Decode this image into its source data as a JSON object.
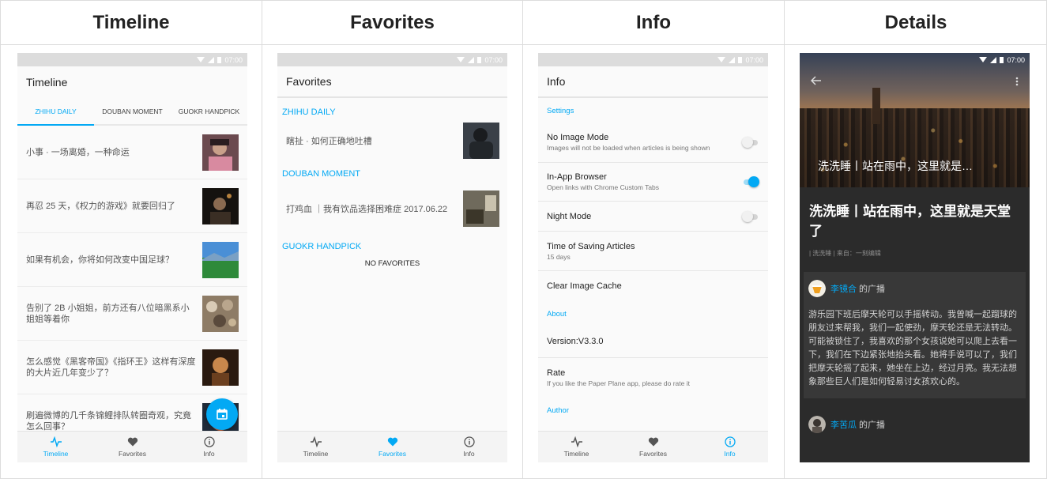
{
  "columns": {
    "timeline": "Timeline",
    "favorites": "Favorites",
    "info": "Info",
    "details": "Details"
  },
  "status": {
    "time": "07:00"
  },
  "nav": {
    "timeline": "Timeline",
    "favorites": "Favorites",
    "info": "Info"
  },
  "colors": {
    "accent": "#03a9f4"
  },
  "timeline": {
    "title": "Timeline",
    "tabs": [
      "ZHIHU DAILY",
      "DOUBAN MOMENT",
      "GUOKR HANDPICK"
    ],
    "items": [
      "小事 · 一场离婚，一种命运",
      "再忍 25 天，《权力的游戏》就要回归了",
      "如果有机会，你将如何改变中国足球？",
      "告别了 2B 小姐姐，前方还有八位暗黑系小姐姐等着你",
      "怎么感觉《黑客帝国》《指环王》这样有深度的大片近几年变少了？",
      "刷遍微博的几千条锦鲤排队转圈奇观，究竟怎么回事？"
    ]
  },
  "favorites": {
    "title": "Favorites",
    "sections": {
      "zhihu": "ZHIHU DAILY",
      "douban": "DOUBAN MOMENT",
      "guokr": "GUOKR HANDPICK"
    },
    "zhihu_item": "瞎扯 · 如何正确地吐槽",
    "douban_item": "打鸡血 ｜我有饮品选择困难症 2017.06.22",
    "empty": "NO FAVORITES"
  },
  "info": {
    "title": "Info",
    "settings_header": "Settings",
    "no_image_title": "No Image Mode",
    "no_image_sub": "Images will not be loaded when articles is being shown",
    "browser_title": "In-App Browser",
    "browser_sub": "Open links with Chrome Custom Tabs",
    "night_title": "Night Mode",
    "saving_title": "Time of Saving Articles",
    "saving_sub": "15 days",
    "cache_title": "Clear Image Cache",
    "about_header": "About",
    "version": "Version:V3.3.0",
    "rate_title": "Rate",
    "rate_sub": "If you like the Paper Plane app, please do rate it",
    "author_header": "Author"
  },
  "details": {
    "hero_title": "洗洗睡丨站在雨中，这里就是…",
    "title": "洗洗睡丨站在雨中，这里就是天堂了",
    "meta": "| 洗洗睡 | 来自：一刻编辑",
    "card1_author": "李镜合",
    "card1_suffix": " 的广播",
    "card1_body": "游乐园下班后摩天轮可以手摇转动。我曾喊一起蹓球的朋友过来帮我，我们一起使劲，摩天轮还是无法转动。可能被锁住了，我喜欢的那个女孩说她可以爬上去看一下，我们在下边紧张地抬头看。她将手说可以了，我们把摩天轮摇了起来，她坐在上边，经过月亮。我无法想象那些巨人们是如何轻易讨女孩欢心的。",
    "card2_author": "李苦瓜",
    "card2_suffix": " 的广播"
  }
}
